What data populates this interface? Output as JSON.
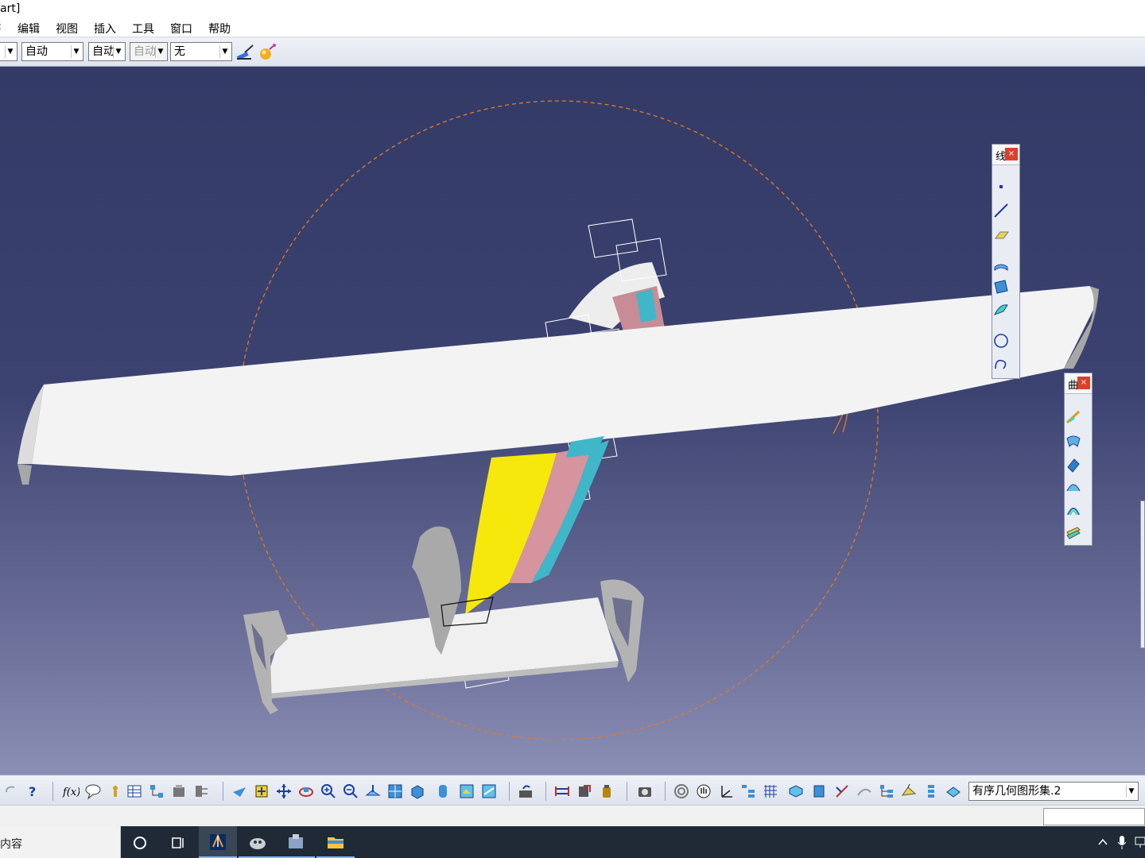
{
  "window": {
    "title_fragment": "art]"
  },
  "menu": {
    "items": [
      "文件",
      "编辑",
      "视图",
      "插入",
      "工具",
      "窗口",
      "帮助"
    ],
    "partial_first": "‡"
  },
  "style_toolbar": {
    "combo_auto": "自动",
    "combo_auto2": "自动",
    "combo_auto3": "自动",
    "combo_none": "无"
  },
  "float_toolbar_1": {
    "title": "线",
    "close": "×"
  },
  "float_toolbar_2": {
    "title": "曲",
    "close": "×"
  },
  "bottom_toolbar": {
    "geometry_set_value": "有序几何图形集.2"
  },
  "taskbar": {
    "search_text": "内容"
  },
  "colors": {
    "viewport_top": "#343a66",
    "viewport_bottom": "#8b8fb5",
    "compass_circle": "#e07a2a",
    "wing": "#f4f4f4",
    "fin_yellow": "#f6e80a",
    "tail_grey": "#a7a7a7"
  },
  "icons": {
    "style_toolbar": [
      "paint-brush-icon",
      "color-ball-icon"
    ],
    "float_toolbar_1": [
      "point-icon",
      "line-icon",
      "plane-icon",
      "extrude-surface-icon",
      "fill-icon",
      "sweep-icon",
      "circle-icon",
      "spline-icon"
    ],
    "float_toolbar_2": [
      "multi-section-icon",
      "blend-icon",
      "offset-icon",
      "fillet-icon",
      "loft-icon",
      "layer-icon"
    ]
  }
}
